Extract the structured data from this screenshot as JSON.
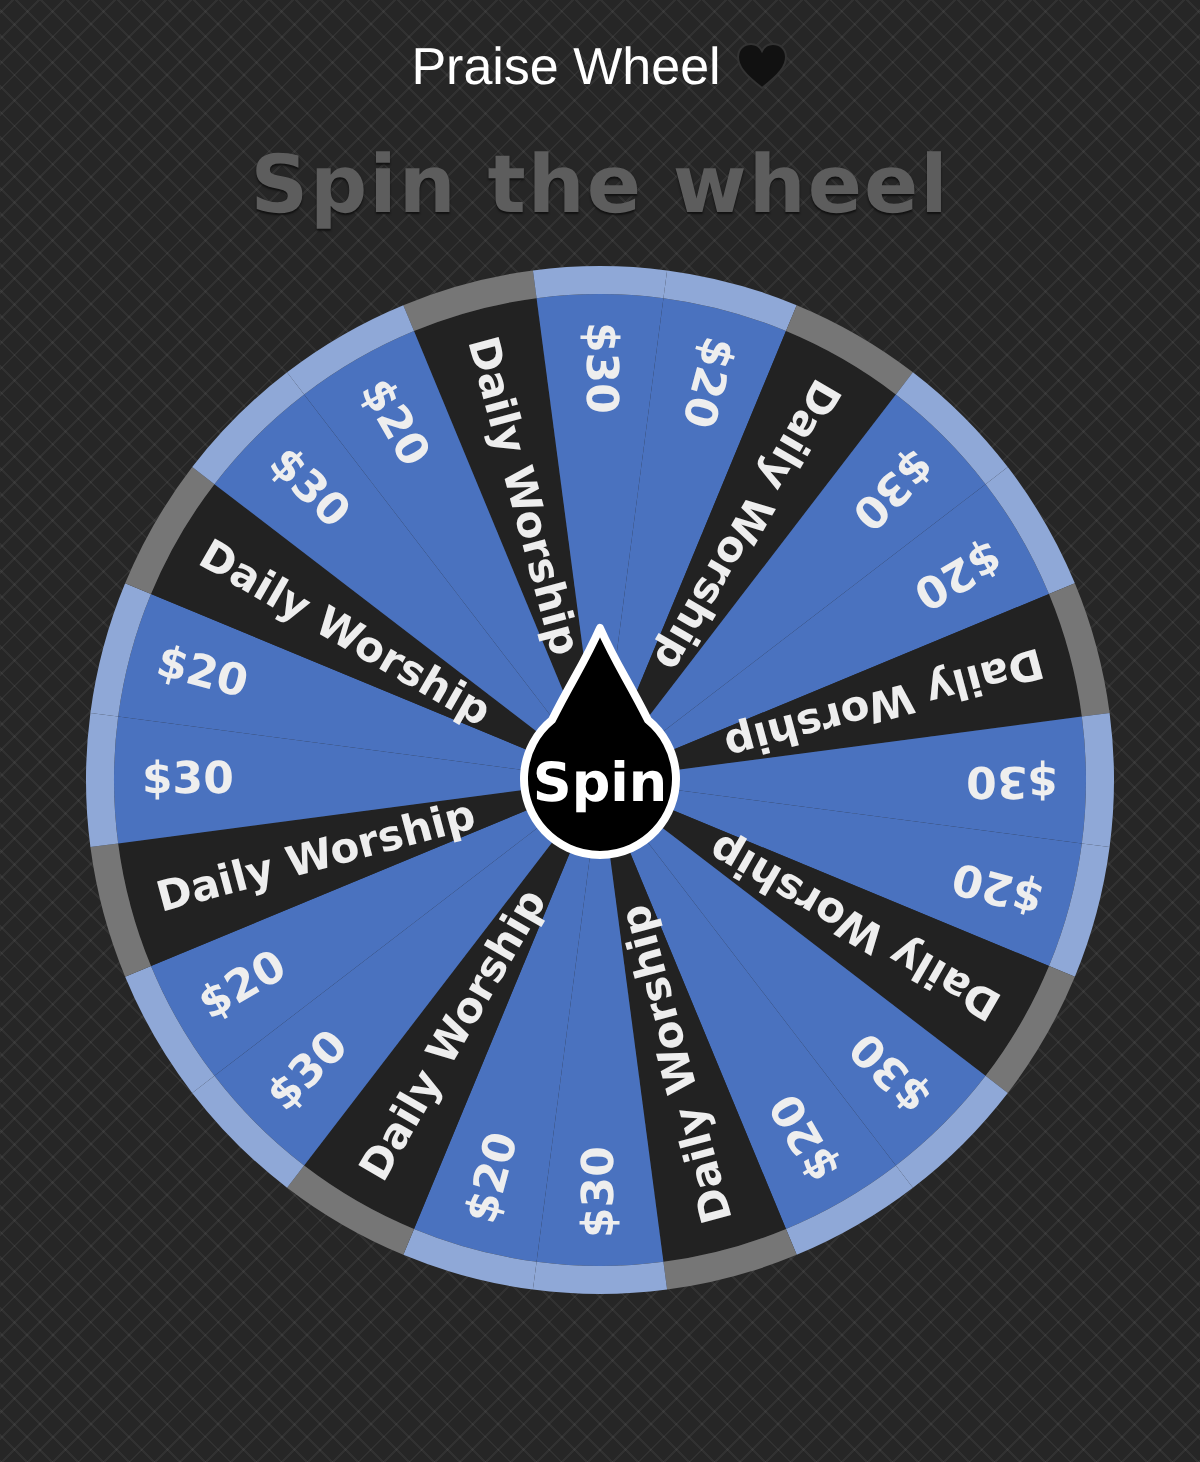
{
  "title": "Praise Wheel",
  "heading": "Spin the wheel",
  "wheel": {
    "spin_button": "Spin",
    "segments": [
      {
        "label": "Daily Worship",
        "color": "#222222"
      },
      {
        "label": "$30",
        "color": "#4a72bf"
      },
      {
        "label": "$20",
        "color": "#4a72bf"
      },
      {
        "label": "Daily Worship",
        "color": "#222222"
      },
      {
        "label": "$30",
        "color": "#4a72bf"
      },
      {
        "label": "$20",
        "color": "#4a72bf"
      },
      {
        "label": "Daily Worship",
        "color": "#222222"
      },
      {
        "label": "$30",
        "color": "#4a72bf"
      },
      {
        "label": "$20",
        "color": "#4a72bf"
      },
      {
        "label": "Daily Worship",
        "color": "#222222"
      },
      {
        "label": "$30",
        "color": "#4a72bf"
      },
      {
        "label": "$20",
        "color": "#4a72bf"
      },
      {
        "label": "Daily Worship",
        "color": "#222222"
      },
      {
        "label": "$30",
        "color": "#4a72bf"
      },
      {
        "label": "$20",
        "color": "#4a72bf"
      },
      {
        "label": "Daily Worship",
        "color": "#222222"
      },
      {
        "label": "$30",
        "color": "#4a72bf"
      },
      {
        "label": "$20",
        "color": "#4a72bf"
      },
      {
        "label": "Daily Worship",
        "color": "#222222"
      },
      {
        "label": "$30",
        "color": "#4a72bf"
      },
      {
        "label": "$20",
        "color": "#4a72bf"
      },
      {
        "label": "Daily Worship",
        "color": "#222222"
      },
      {
        "label": "$30",
        "color": "#4a72bf"
      },
      {
        "label": "$20",
        "color": "#4a72bf"
      }
    ]
  }
}
